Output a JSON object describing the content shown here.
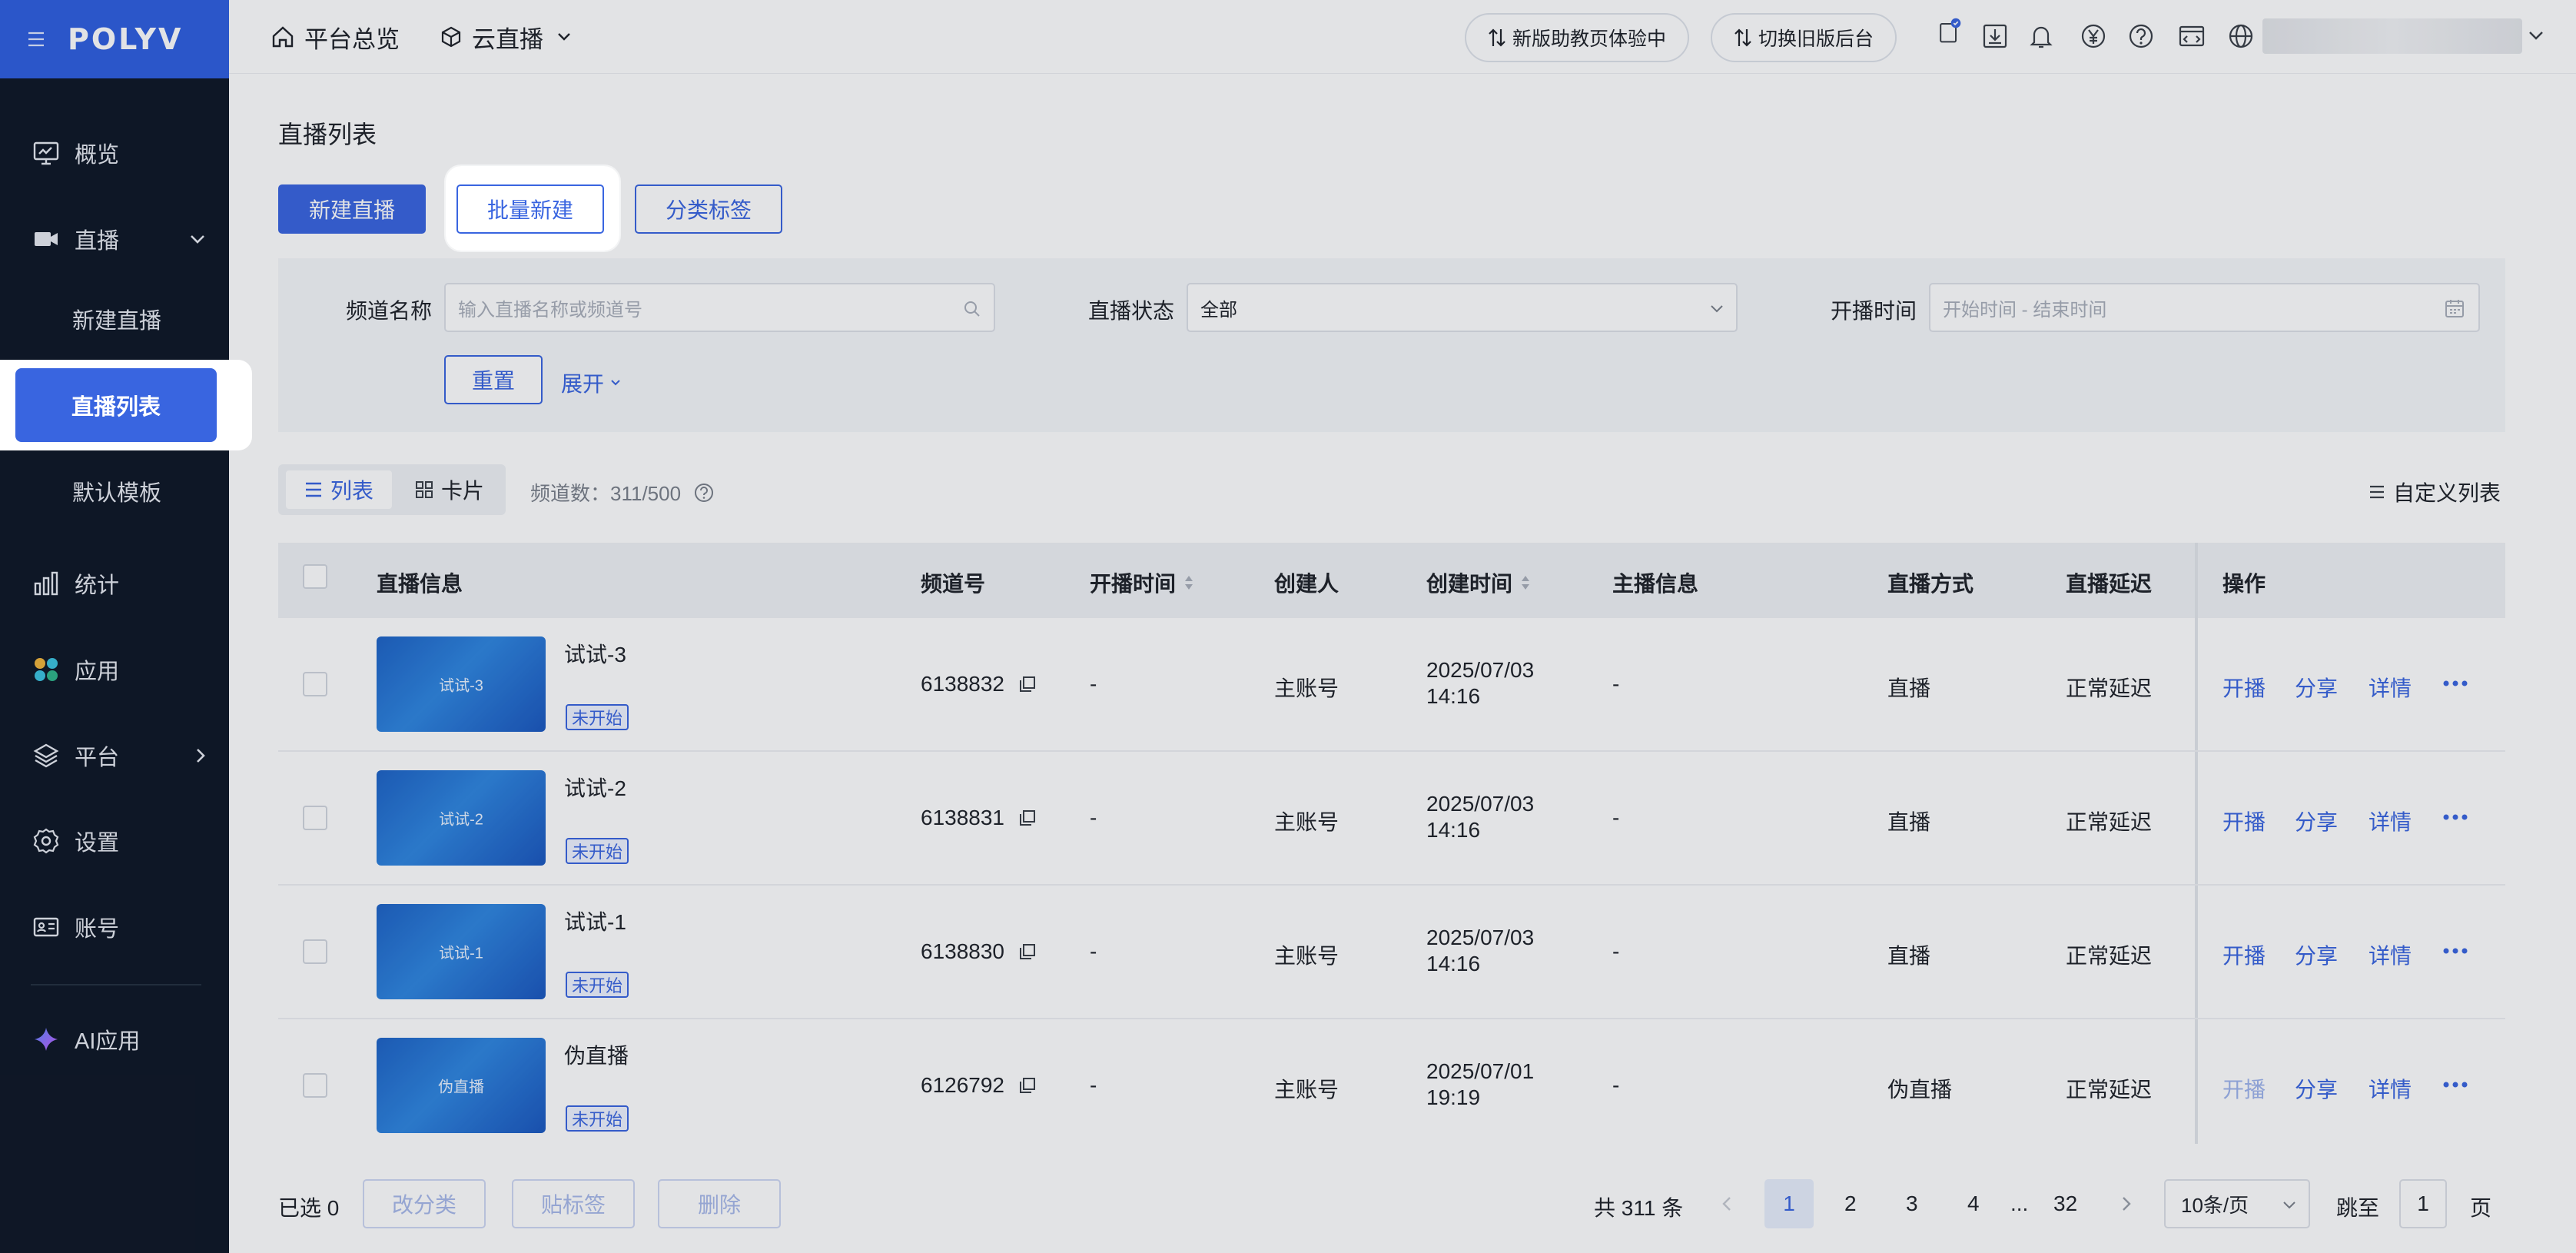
{
  "sidebar": {
    "logo": "POLYV",
    "items": [
      {
        "label": "概览",
        "icon": "monitor-icon"
      },
      {
        "label": "直播",
        "icon": "video-camera-icon"
      },
      {
        "label": "新建直播"
      },
      {
        "label": "直播列表"
      },
      {
        "label": "默认模板"
      },
      {
        "label": "统计",
        "icon": "bar-chart-icon"
      },
      {
        "label": "应用",
        "icon": "apps-icon"
      },
      {
        "label": "平台",
        "icon": "layers-icon"
      },
      {
        "label": "设置",
        "icon": "gear-icon"
      },
      {
        "label": "账号",
        "icon": "id-card-icon"
      },
      {
        "label": "AI应用",
        "icon": "sparkle-icon"
      }
    ]
  },
  "header": {
    "tab_overview": "平台总览",
    "tab_live": "云直播",
    "pill_new_home": "新版助教页体验中",
    "pill_switch_old": "切换旧版后台"
  },
  "page": {
    "title": "直播列表",
    "btn_new": "新建直播",
    "btn_batch": "批量新建",
    "btn_tags": "分类标签"
  },
  "filters": {
    "name_label": "频道名称",
    "name_placeholder": "输入直播名称或频道号",
    "status_label": "直播状态",
    "status_value": "全部",
    "time_label": "开播时间",
    "time_placeholder": "开始时间 - 结束时间",
    "reset": "重置",
    "expand": "展开"
  },
  "toolbar": {
    "view_list": "列表",
    "view_card": "卡片",
    "channel_count": "频道数：311/500",
    "custom_list": "自定义列表"
  },
  "table": {
    "columns": [
      "直播信息",
      "频道号",
      "开播时间",
      "创建人",
      "创建时间",
      "主播信息",
      "直播方式",
      "直播延迟",
      "操作"
    ],
    "rows": [
      {
        "title": "试试-3",
        "thumb": "试试-3",
        "status": "未开始",
        "channel": "6138832",
        "start": "-",
        "creator": "主账号",
        "created_date": "2025/07/03",
        "created_time": "14:16",
        "host": "-",
        "mode": "直播",
        "delay": "正常延迟",
        "ops": [
          "开播",
          "分享",
          "详情"
        ],
        "start_enabled": true
      },
      {
        "title": "试试-2",
        "thumb": "试试-2",
        "status": "未开始",
        "channel": "6138831",
        "start": "-",
        "creator": "主账号",
        "created_date": "2025/07/03",
        "created_time": "14:16",
        "host": "-",
        "mode": "直播",
        "delay": "正常延迟",
        "ops": [
          "开播",
          "分享",
          "详情"
        ],
        "start_enabled": true
      },
      {
        "title": "试试-1",
        "thumb": "试试-1",
        "status": "未开始",
        "channel": "6138830",
        "start": "-",
        "creator": "主账号",
        "created_date": "2025/07/03",
        "created_time": "14:16",
        "host": "-",
        "mode": "直播",
        "delay": "正常延迟",
        "ops": [
          "开播",
          "分享",
          "详情"
        ],
        "start_enabled": true
      },
      {
        "title": "伪直播",
        "thumb": "伪直播",
        "status": "未开始",
        "channel": "6126792",
        "start": "-",
        "creator": "主账号",
        "created_date": "2025/07/01",
        "created_time": "19:19",
        "host": "-",
        "mode": "伪直播",
        "delay": "正常延迟",
        "ops": [
          "开播",
          "分享",
          "详情"
        ],
        "start_enabled": false
      }
    ]
  },
  "footer": {
    "selected": "已选 0",
    "btn_category": "改分类",
    "btn_tag": "贴标签",
    "btn_delete": "删除",
    "total": "共 311 条",
    "pages": [
      "1",
      "2",
      "3",
      "4",
      "...",
      "32"
    ],
    "current_page": "1",
    "page_size": "10条/页",
    "goto_label": "跳至",
    "goto_value": "1",
    "page_unit": "页"
  },
  "colors": {
    "accent": "#3965e0",
    "sidebar_bg": "#0e1726",
    "logo_bar": "#2f5fe0"
  }
}
